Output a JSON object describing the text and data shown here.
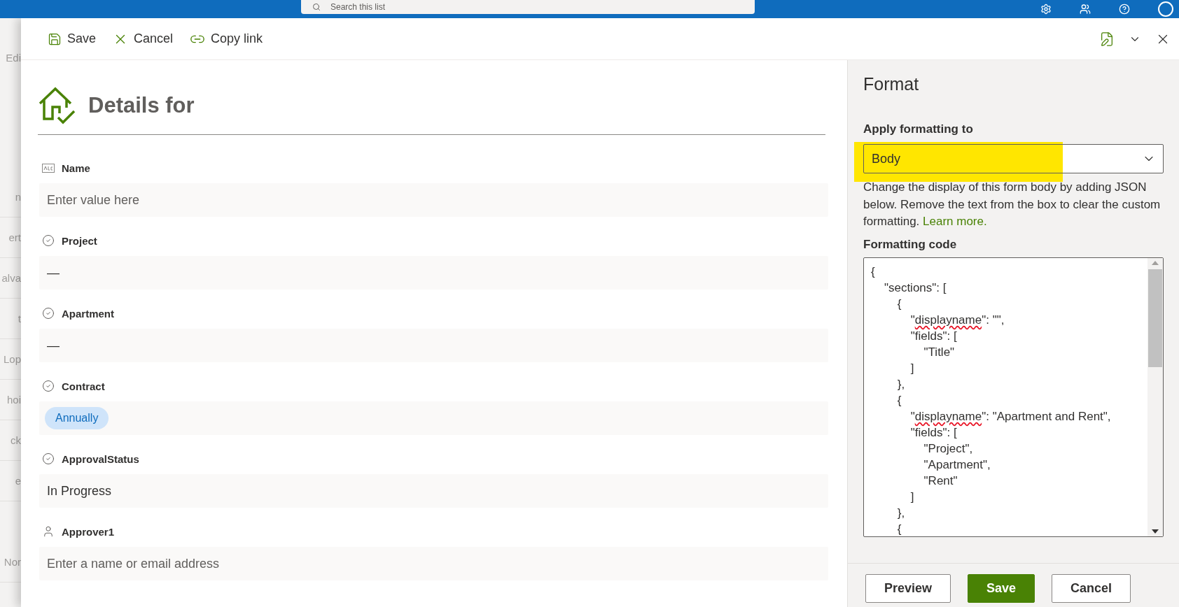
{
  "top_bar": {
    "search": {
      "placeholder": "Search this list"
    }
  },
  "background_list": {
    "items": [
      "Edi",
      "n",
      "ert",
      "alva",
      "t",
      "Lop",
      "hoi",
      "ck",
      "e",
      "Nor"
    ]
  },
  "toolbar": {
    "actions": [
      {
        "kind": "save",
        "label": "Save"
      },
      {
        "kind": "cancel",
        "label": "Cancel"
      },
      {
        "kind": "link",
        "label": "Copy link"
      }
    ]
  },
  "form": {
    "title": "Details for",
    "fields": [
      {
        "label": "Name",
        "kind": "text",
        "placeholder": "Enter value here"
      },
      {
        "label": "Project",
        "kind": "choice",
        "value": "—"
      },
      {
        "label": "Apartment",
        "kind": "choice",
        "value": "—"
      },
      {
        "label": "Contract",
        "kind": "tag",
        "value": "Annually"
      },
      {
        "label": "ApprovalStatus",
        "kind": "choice",
        "value": "In Progress"
      },
      {
        "label": "Approver1",
        "kind": "person",
        "placeholder": "Enter a name or email address"
      }
    ]
  },
  "format_panel": {
    "title": "Format",
    "apply_label": "Apply formatting to",
    "apply_dropdown": {
      "value": "Body",
      "highlighted": true
    },
    "description": "Change the display of this form body by adding JSON below. Remove the text from the box to clear the custom formatting.",
    "learn_more": "Learn more.",
    "code_label": "Formatting code",
    "code_lines": [
      [
        {
          "text": "{"
        }
      ],
      [
        {
          "text": "    \"sections\": ["
        }
      ],
      [
        {
          "text": "        {"
        }
      ],
      [
        {
          "text": "            \"",
          "misspelled": false
        },
        {
          "text": "displayname",
          "misspelled": true
        },
        {
          "text": "\": \"\",",
          "misspelled": false
        }
      ],
      [
        {
          "text": "            \"fields\": ["
        }
      ],
      [
        {
          "text": "                \"Title\""
        }
      ],
      [
        {
          "text": "            ]"
        }
      ],
      [
        {
          "text": "        },"
        }
      ],
      [
        {
          "text": "        {"
        }
      ],
      [
        {
          "text": "            \"",
          "misspelled": false
        },
        {
          "text": "displayname",
          "misspelled": true
        },
        {
          "text": "\": \"Apartment and Rent\",",
          "misspelled": false
        }
      ],
      [
        {
          "text": "            \"fields\": ["
        }
      ],
      [
        {
          "text": "                \"Project\","
        }
      ],
      [
        {
          "text": "                \"Apartment\","
        }
      ],
      [
        {
          "text": "                \"Rent\""
        }
      ],
      [
        {
          "text": "            ]"
        }
      ],
      [
        {
          "text": "        },"
        }
      ],
      [
        {
          "text": "        {"
        }
      ]
    ],
    "buttons": [
      {
        "label": "Preview",
        "primary": false
      },
      {
        "label": "Save",
        "primary": true
      },
      {
        "label": "Cancel",
        "primary": false
      }
    ]
  }
}
